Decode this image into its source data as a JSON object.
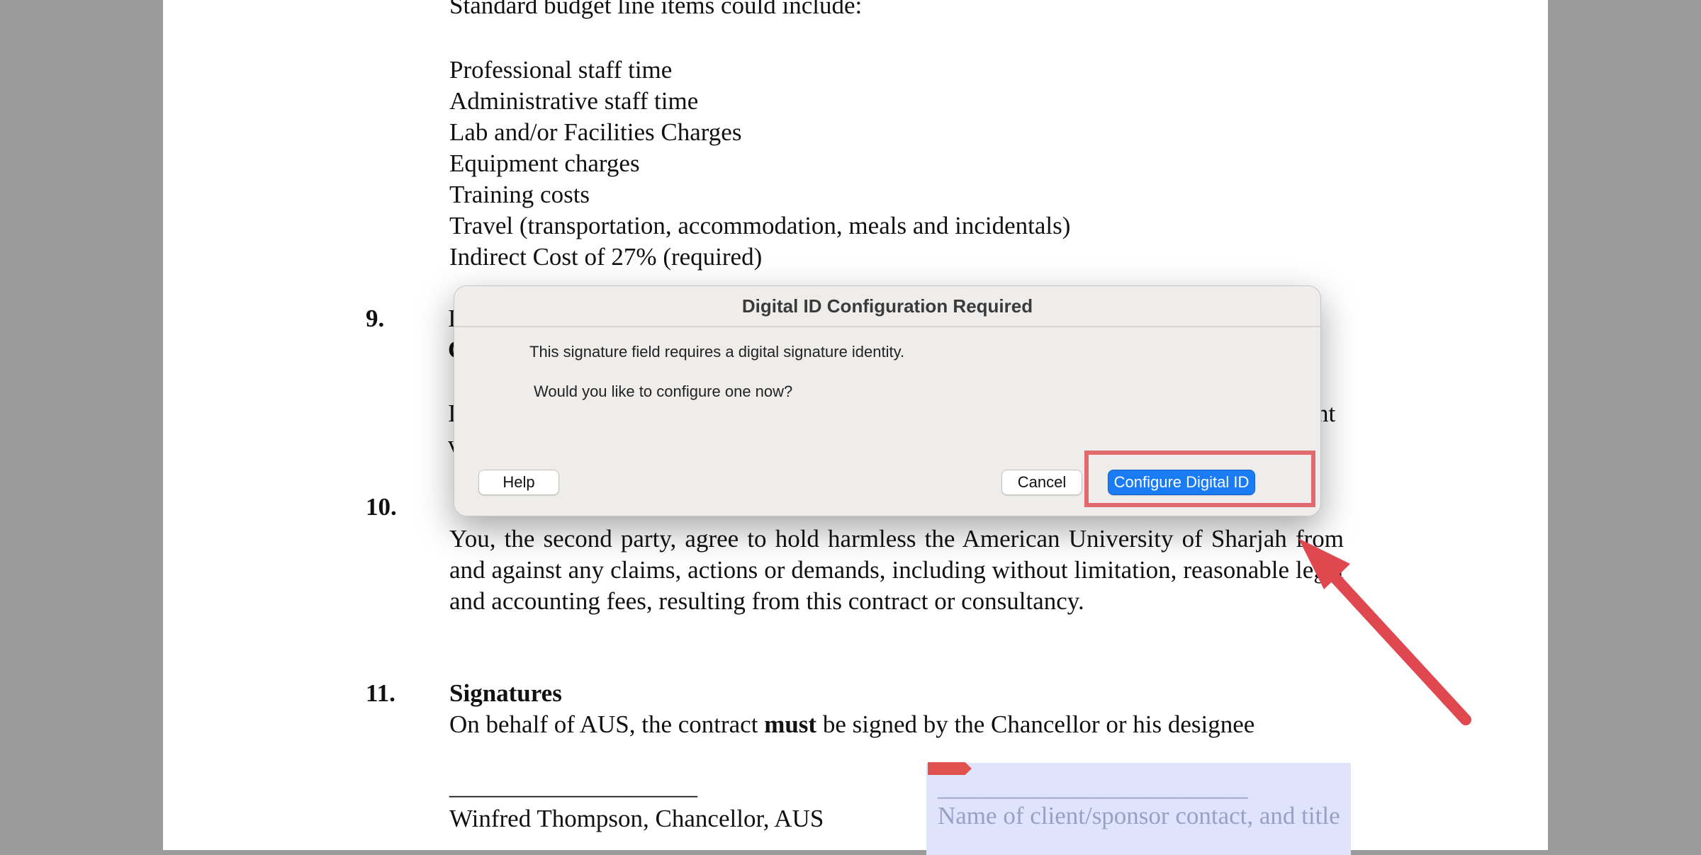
{
  "document": {
    "intro": "Standard budget line items could include:",
    "budget_items": [
      "Professional staff time",
      "Administrative staff time",
      "Lab and/or Facilities Charges",
      "Equipment charges",
      "Training costs",
      "Travel (transportation, accommodation, meals and incidentals)",
      "Indirect Cost of 27% (required)"
    ],
    "section9": {
      "number": "9.",
      "line1": "I",
      "line2": "C",
      "line3_start": "I",
      "line3_end": "nt",
      "line4": "v"
    },
    "section10": {
      "number": "10.",
      "body": "You, the second party, agree to hold harmless the American University of Sharjah from and against any claims, actions or demands, including without limitation, reasonable legal and accounting fees, resulting from this contract or consultancy."
    },
    "section11": {
      "number": "11.",
      "heading": "Signatures",
      "body_before": "On behalf of AUS, the contract ",
      "body_bold": "must",
      "body_after": " be signed by the Chancellor or his designee"
    },
    "signature_left": {
      "line": "____________________",
      "name": "Winfred Thompson, Chancellor, AUS"
    },
    "signature_right": {
      "line": "_________________________",
      "placeholder": "Name of client/sponsor contact, and title"
    }
  },
  "dialog": {
    "title": "Digital ID Configuration Required",
    "message": "This signature field requires a digital signature identity.",
    "question": "Would you like to configure one now?",
    "help_label": "Help",
    "cancel_label": "Cancel",
    "configure_label": "Configure Digital ID"
  },
  "colors": {
    "primary_button": "#1a7cf4",
    "annotation": "#e0484f"
  }
}
